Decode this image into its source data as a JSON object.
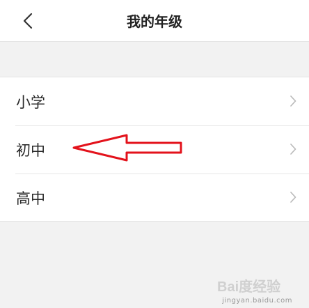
{
  "header": {
    "title": "我的年级",
    "back_icon": "chevron-left-icon"
  },
  "grades": {
    "items": [
      {
        "label": "小学",
        "icon": "chevron-right-icon"
      },
      {
        "label": "初中",
        "icon": "chevron-right-icon"
      },
      {
        "label": "高中",
        "icon": "chevron-right-icon"
      }
    ]
  },
  "annotation": {
    "type": "arrow",
    "points_to": "初中",
    "color": "#e3121b"
  },
  "watermark": {
    "text": "Bai度经验",
    "url_text": "jingyan.baidu.com"
  },
  "colors": {
    "background": "#f2f2f2",
    "surface": "#ffffff",
    "divider": "#e6e6e6",
    "text": "#2a2a2a",
    "chevron": "#b8b8b8"
  }
}
